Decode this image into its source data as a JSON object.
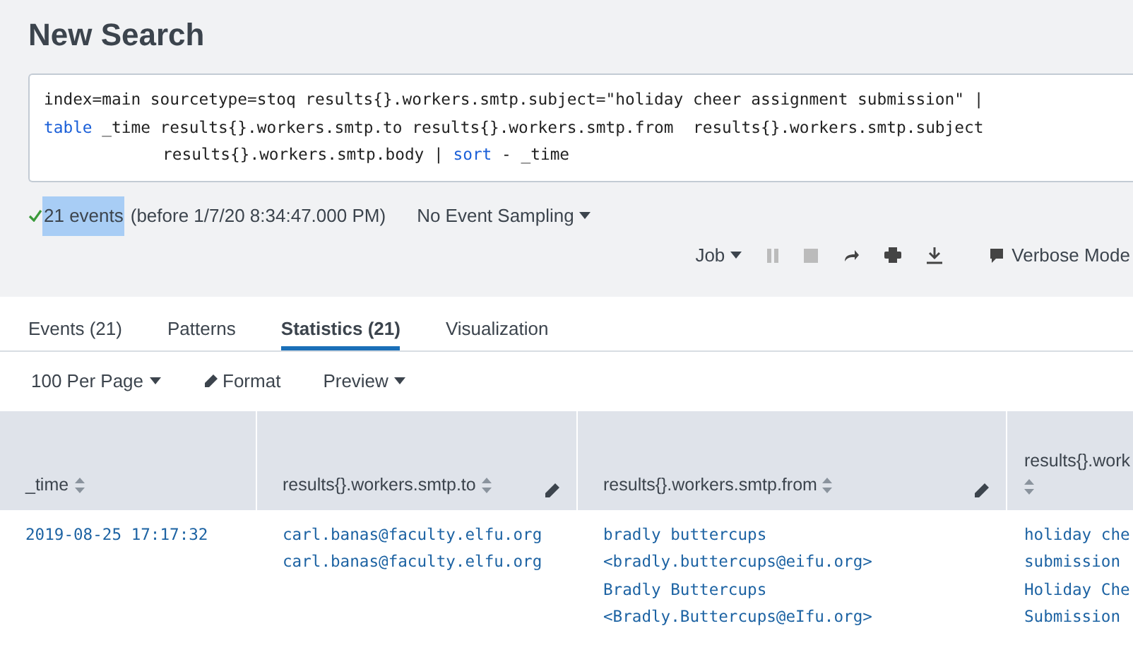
{
  "page_title": "New Search",
  "query": [
    {
      "indented": false,
      "parts": [
        {
          "kind": "plain",
          "text": "index=main sourcetype=stoq results{}.workers.smtp.subject=\"holiday cheer assignment submission\" |"
        }
      ]
    },
    {
      "indented": false,
      "parts": [
        {
          "kind": "keyword",
          "text": "table"
        },
        {
          "kind": "plain",
          "text": " _time results{}.workers.smtp.to results{}.workers.smtp.from  results{}.workers.smtp.subject"
        }
      ]
    },
    {
      "indented": true,
      "parts": [
        {
          "kind": "plain",
          "text": "results{}.workers.smtp.body | "
        },
        {
          "kind": "keyword",
          "text": "sort"
        },
        {
          "kind": "plain",
          "text": " - _time"
        }
      ]
    }
  ],
  "status": {
    "count": "21 events",
    "count_highlighted": true,
    "detail": "(before 1/7/20 8:34:47.000 PM)",
    "sampling": "No Event Sampling"
  },
  "job_toolbar": {
    "job": "Job",
    "mode": "Verbose Mode"
  },
  "tabs": [
    {
      "label": "Events (21)",
      "selected": false
    },
    {
      "label": "Patterns",
      "selected": false
    },
    {
      "label": "Statistics (21)",
      "selected": true
    },
    {
      "label": "Visualization",
      "selected": false
    }
  ],
  "table_toolbar": [
    {
      "kind": "dropdown",
      "label": "100 Per Page"
    },
    {
      "kind": "edit",
      "label": "Format"
    },
    {
      "kind": "dropdown",
      "label": "Preview"
    }
  ],
  "table": {
    "columns": [
      {
        "label": "_time",
        "editable": false,
        "wrap_sort": false
      },
      {
        "label": "results{}.workers.smtp.to",
        "editable": true,
        "wrap_sort": false
      },
      {
        "label": "results{}.workers.smtp.from",
        "editable": true,
        "wrap_sort": false
      },
      {
        "label": "results{}.work",
        "editable": false,
        "wrap_sort": true
      }
    ],
    "rows": [
      [
        [
          "2019-08-25 17:17:32"
        ],
        [
          "carl.banas@faculty.elfu.org",
          "carl.banas@faculty.elfu.org"
        ],
        [
          "bradly buttercups",
          "<bradly.buttercups@eifu.org>",
          "Bradly Buttercups",
          "<Bradly.Buttercups@eIfu.org>"
        ],
        [
          "holiday che",
          "submission",
          "Holiday Che",
          "Submission"
        ]
      ]
    ]
  }
}
